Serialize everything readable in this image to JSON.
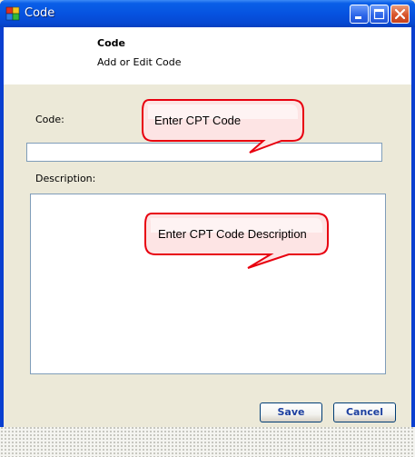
{
  "window": {
    "title": "Code",
    "controls": {
      "minimize": "minimize-icon",
      "maximize": "maximize-icon",
      "close": "close-icon"
    }
  },
  "header": {
    "title": "Code",
    "subtitle": "Add or Edit Code"
  },
  "form": {
    "code_label": "Code:",
    "code_value": "",
    "description_label": "Description:",
    "description_value": ""
  },
  "callouts": {
    "code_hint": "Enter CPT Code",
    "description_hint": "Enter CPT Code Description"
  },
  "buttons": {
    "save": "Save",
    "cancel": "Cancel"
  },
  "colors": {
    "titlebar": "#0653e0",
    "callout_border": "#e8000f",
    "callout_fill": "#ffe6e6",
    "button_text": "#1c3fa0"
  }
}
